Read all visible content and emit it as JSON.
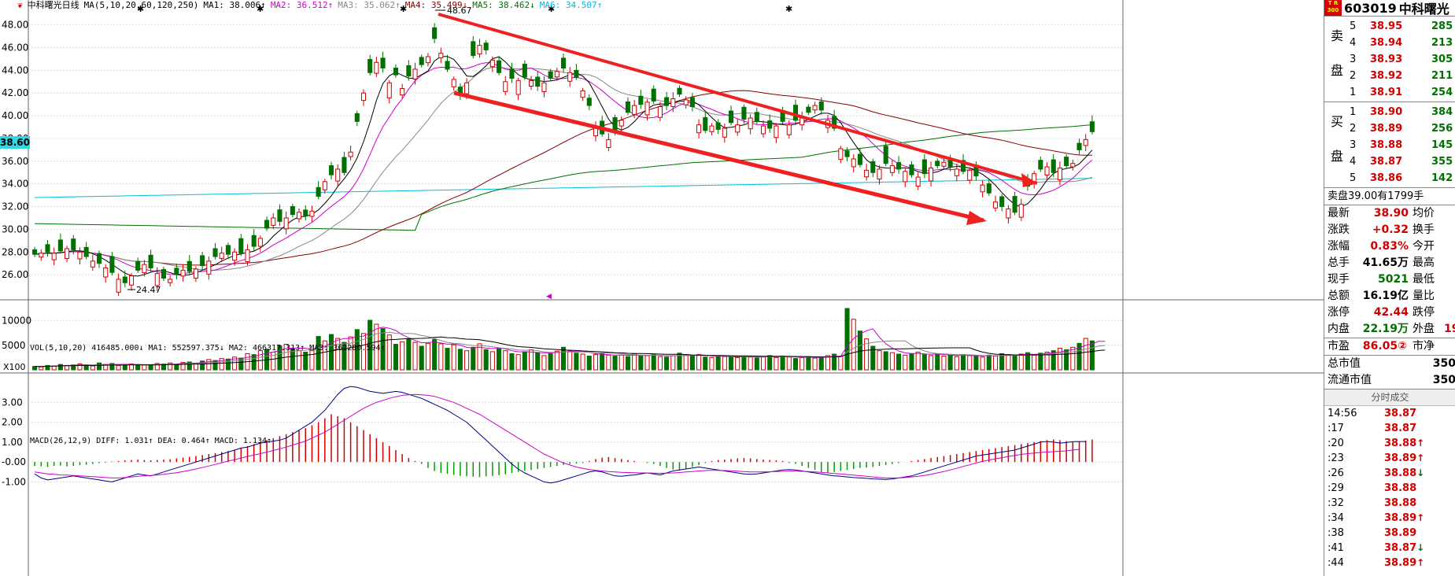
{
  "header": {
    "title_icon": "stock-logo-icon",
    "name": "中科曙光日线",
    "ma_params": "MA(5,10,20,60,120,250)",
    "ma": [
      {
        "label": "MA1: 38.006↑",
        "color": "#000000"
      },
      {
        "label": "MA2: 36.512↑",
        "color": "#cc00cc"
      },
      {
        "label": "MA3: 35.062↑",
        "color": "#888888"
      },
      {
        "label": "MA4: 35.499↓",
        "color": "#880000"
      },
      {
        "label": "MA5: 38.462↓",
        "color": "#007000"
      },
      {
        "label": "MA6: 34.507↑",
        "color": "#00b8d8"
      }
    ]
  },
  "price_axis": {
    "ticks": [
      "48.00",
      "46.00",
      "44.00",
      "42.00",
      "40.00",
      "38.00",
      "36.00",
      "34.00",
      "32.00",
      "30.00",
      "28.00",
      "26.00"
    ],
    "current": "38.60"
  },
  "annotations": {
    "high": "48.67",
    "low": "24.47"
  },
  "volume": {
    "header": "VOL(5,10,20) 416485.000↓ MA1: 552597.375↓ MA2: 466317.313↑ MA3: 362280.594↑",
    "ticks": [
      "10000",
      "5000"
    ],
    "unit": "X100"
  },
  "macd": {
    "header": "MACD(26,12,9) DIFF: 1.031↑ DEA: 0.464↑ MACD: 1.134↑",
    "ticks": [
      "3.00",
      "2.00",
      "1.00",
      "-0.00",
      "-1.00"
    ]
  },
  "right_panel": {
    "code": "603019",
    "name": "中科曙光",
    "logo_text": "T R 300",
    "sell_label": "卖盘",
    "buy_label": "买盘",
    "asks": [
      {
        "lv": "5",
        "price": "38.95",
        "vol": "285"
      },
      {
        "lv": "4",
        "price": "38.94",
        "vol": "213"
      },
      {
        "lv": "3",
        "price": "38.93",
        "vol": "305"
      },
      {
        "lv": "2",
        "price": "38.92",
        "vol": "211"
      },
      {
        "lv": "1",
        "price": "38.91",
        "vol": "254"
      }
    ],
    "bids": [
      {
        "lv": "1",
        "price": "38.90",
        "vol": "384"
      },
      {
        "lv": "2",
        "price": "38.89",
        "vol": "256"
      },
      {
        "lv": "3",
        "price": "38.88",
        "vol": "145"
      },
      {
        "lv": "4",
        "price": "38.87",
        "vol": "355"
      },
      {
        "lv": "5",
        "price": "38.86",
        "vol": "142"
      }
    ],
    "sell_line": "卖盘39.00有1799手",
    "info": [
      {
        "k": "最新",
        "v": "38.90",
        "k2": "均价",
        "c": "red"
      },
      {
        "k": "涨跌",
        "v": "+0.32",
        "k2": "换手",
        "c": "red"
      },
      {
        "k": "涨幅",
        "v": "0.83%",
        "k2": "今开",
        "c": "red"
      },
      {
        "k": "总手",
        "v": "41.65万",
        "k2": "最高",
        "c": ""
      },
      {
        "k": "现手",
        "v": "5021",
        "k2": "最低",
        "c": "grn"
      },
      {
        "k": "总额",
        "v": "16.19亿",
        "k2": "量比",
        "c": ""
      },
      {
        "k": "涨停",
        "v": "42.44",
        "k2": "跌停",
        "c": "red"
      },
      {
        "k": "内盘",
        "v": "22.19万",
        "k2": "外盘",
        "c": "grn"
      }
    ],
    "outer_frag": "19",
    "pe": {
      "k": "市盈",
      "v": "86.05②",
      "k2": "市净"
    },
    "cap": [
      {
        "k": "总市值",
        "v": "350"
      },
      {
        "k": "流通市值",
        "v": "350"
      }
    ],
    "ticks_header": "分时成交",
    "ticks": [
      {
        "t": "14:56",
        "p": "38.87",
        "a": ""
      },
      {
        "t": ":17",
        "p": "38.87",
        "a": ""
      },
      {
        "t": ":20",
        "p": "38.88",
        "a": "↑"
      },
      {
        "t": ":23",
        "p": "38.89",
        "a": "↑"
      },
      {
        "t": ":26",
        "p": "38.88",
        "a": "↓"
      },
      {
        "t": ":29",
        "p": "38.88",
        "a": ""
      },
      {
        "t": ":32",
        "p": "38.88",
        "a": ""
      },
      {
        "t": ":34",
        "p": "38.89",
        "a": "↑"
      },
      {
        "t": ":38",
        "p": "38.89",
        "a": ""
      },
      {
        "t": ":41",
        "p": "38.87",
        "a": "↓"
      },
      {
        "t": ":44",
        "p": "38.89",
        "a": "↑"
      }
    ]
  },
  "chart_data": {
    "type": "candlestick",
    "ylim": [
      24,
      49.5
    ],
    "close": [
      27.8,
      27.9,
      28.0,
      27.9,
      28.1,
      28.3,
      28.2,
      28.0,
      27.6,
      27.2,
      27.0,
      26.6,
      26.2,
      25.6,
      25.3,
      25.9,
      26.4,
      26.9,
      26.6,
      26.1,
      25.7,
      25.6,
      26.0,
      26.4,
      26.3,
      26.5,
      26.8,
      27.2,
      27.6,
      27.9,
      27.8,
      28.0,
      27.9,
      28.2,
      28.5,
      29.2,
      30.1,
      31.0,
      30.7,
      31.0,
      31.3,
      31.5,
      31.2,
      31.6,
      32.9,
      34.2,
      34.8,
      35.3,
      35.0,
      36.8,
      39.5,
      42.0,
      43.8,
      44.7,
      44.2,
      42.9,
      43.6,
      42.4,
      43.5,
      44.1,
      44.5,
      45.2,
      46.8,
      45.5,
      44.1,
      43.2,
      41.8,
      42.9,
      45.3,
      46.2,
      45.8,
      44.9,
      43.8,
      43.0,
      43.3,
      43.1,
      43.4,
      43.1,
      42.6,
      42.9,
      43.3,
      43.9,
      44.2,
      43.8,
      43.4,
      42.2,
      40.9,
      39.1,
      38.4,
      37.9,
      38.7,
      39.6,
      40.3,
      40.9,
      41.0,
      41.2,
      41.3,
      40.8,
      40.9,
      41.5,
      41.9,
      41.4,
      40.8,
      39.2,
      38.7,
      39.1,
      38.8,
      38.9,
      39.4,
      39.2,
      39.7,
      39.8,
      39.5,
      39.1,
      38.9,
      39.1,
      39.5,
      39.2,
      39.6,
      39.8,
      40.3,
      40.9,
      40.5,
      39.6,
      38.9,
      37.1,
      36.4,
      36.2,
      35.7,
      35.2,
      35.0,
      35.3,
      35.8,
      35.6,
      35.3,
      35.1,
      34.8,
      34.6,
      34.9,
      35.4,
      35.6,
      35.9,
      35.5,
      35.3,
      35.1,
      35.2,
      34.7,
      33.9,
      33.2,
      32.4,
      32.0,
      31.8,
      31.5,
      32.2,
      33.8,
      34.9,
      35.3,
      35.5,
      35.0,
      35.4,
      35.6,
      35.8,
      37.0,
      37.9,
      38.6
    ],
    "open_offsets": [
      0.4,
      -0.3,
      0.5,
      -0.4,
      0.6,
      -0.5,
      0.5,
      -0.6,
      0.7,
      -0.4,
      0.6,
      -0.5,
      0.8,
      -0.6,
      0.5,
      -0.7,
      0.6,
      -0.5,
      0.7,
      -0.6
    ],
    "volume": [
      700,
      600,
      900,
      800,
      1100,
      900,
      1000,
      1200,
      900,
      800,
      1400,
      1100,
      1300,
      900,
      1000,
      1200,
      1100,
      1000,
      900,
      1300,
      1200,
      1400,
      1100,
      1500,
      1600,
      1300,
      1800,
      2100,
      1900,
      2300,
      2200,
      2600,
      2400,
      3300,
      3100,
      3900,
      4200,
      3600,
      4900,
      5200,
      4400,
      3900,
      3600,
      3900,
      6800,
      5900,
      7200,
      6400,
      5600,
      6700,
      8200,
      7400,
      10100,
      9300,
      8400,
      7100,
      5200,
      5700,
      6300,
      5600,
      4800,
      5400,
      6200,
      5300,
      4400,
      5100,
      4200,
      3900,
      4600,
      5300,
      4100,
      3700,
      4400,
      3900,
      3300,
      3100,
      3700,
      4100,
      3500,
      2900,
      3300,
      3800,
      4600,
      3900,
      3400,
      3200,
      2800,
      3100,
      3300,
      3000,
      2800,
      3000,
      2700,
      3300,
      2800,
      2900,
      3100,
      2700,
      2600,
      2900,
      3400,
      3000,
      2800,
      3100,
      2600,
      2500,
      2900,
      2700,
      2600,
      2500,
      2800,
      2600,
      2400,
      2700,
      2900,
      2500,
      2800,
      2600,
      2300,
      2500,
      2700,
      2400,
      2600,
      2900,
      3200,
      2800,
      12500,
      10300,
      7900,
      6300,
      4800,
      3900,
      3700,
      3500,
      3200,
      3000,
      3300,
      3600,
      3100,
      2900,
      3200,
      2800,
      3000,
      2700,
      3100,
      2900,
      2800,
      2600,
      3000,
      2800,
      3300,
      3100,
      2900,
      3200,
      3500,
      3000,
      3400,
      3600,
      3900,
      4400,
      4100,
      4600,
      5400,
      6400,
      5900,
      6700,
      4600
    ],
    "macd": [
      -0.2,
      -0.22,
      -0.25,
      -0.2,
      -0.18,
      -0.22,
      -0.2,
      -0.16,
      -0.14,
      -0.1,
      -0.06,
      -0.04,
      0.02,
      0.05,
      0.08,
      0.1,
      0.12,
      0.1,
      0.08,
      0.1,
      0.12,
      0.14,
      0.18,
      0.22,
      0.26,
      0.3,
      0.35,
      0.4,
      0.45,
      0.5,
      0.55,
      0.62,
      0.7,
      0.8,
      0.9,
      1.0,
      1.1,
      1.2,
      1.3,
      1.4,
      1.5,
      1.6,
      1.7,
      1.85,
      2.0,
      2.2,
      2.4,
      2.3,
      2.2,
      2.0,
      1.8,
      1.6,
      1.4,
      1.2,
      1.0,
      0.8,
      0.6,
      0.4,
      0.2,
      0.05,
      -0.1,
      -0.3,
      -0.45,
      -0.55,
      -0.6,
      -0.65,
      -0.7,
      -0.72,
      -0.74,
      -0.76,
      -0.72,
      -0.7,
      -0.66,
      -0.62,
      -0.55,
      -0.5,
      -0.45,
      -0.4,
      -0.35,
      -0.3,
      -0.25,
      -0.2,
      -0.15,
      -0.1,
      -0.08,
      -0.05,
      0.05,
      0.15,
      0.22,
      0.25,
      0.2,
      0.15,
      0.1,
      0.05,
      0.0,
      -0.05,
      -0.1,
      -0.2,
      -0.3,
      -0.38,
      -0.42,
      -0.35,
      -0.25,
      -0.15,
      -0.05,
      0.05,
      0.1,
      0.12,
      0.15,
      0.18,
      0.2,
      0.18,
      0.15,
      0.12,
      0.1,
      0.08,
      0.05,
      -0.05,
      -0.1,
      -0.2,
      -0.3,
      -0.4,
      -0.5,
      -0.55,
      -0.5,
      -0.45,
      -0.4,
      -0.35,
      -0.3,
      -0.28,
      -0.25,
      -0.2,
      -0.15,
      -0.1,
      -0.05,
      0.0,
      0.05,
      0.1,
      0.15,
      0.2,
      0.25,
      0.3,
      0.35,
      0.4,
      0.45,
      0.5,
      0.55,
      0.6,
      0.65,
      0.7,
      0.75,
      0.8,
      0.85,
      0.9,
      0.95,
      1.0,
      1.05,
      1.1,
      1.13,
      1.1,
      1.05,
      1.0,
      1.03,
      1.08,
      1.13
    ],
    "diff": [
      -0.6,
      -0.8,
      -0.9,
      -0.85,
      -0.8,
      -0.75,
      -0.7,
      -0.75,
      -0.8,
      -0.85,
      -0.9,
      -0.95,
      -1.0,
      -0.9,
      -0.8,
      -0.7,
      -0.6,
      -0.65,
      -0.7,
      -0.6,
      -0.5,
      -0.4,
      -0.3,
      -0.2,
      -0.1,
      0.0,
      0.1,
      0.2,
      0.3,
      0.4,
      0.5,
      0.6,
      0.7,
      0.75,
      0.85,
      0.95,
      1.0,
      1.05,
      1.1,
      1.2,
      1.4,
      1.6,
      1.8,
      2.0,
      2.3,
      2.6,
      3.0,
      3.4,
      3.7,
      3.8,
      3.75,
      3.65,
      3.55,
      3.5,
      3.45,
      3.5,
      3.55,
      3.5,
      3.4,
      3.3,
      3.2,
      3.05,
      2.9,
      2.75,
      2.6,
      2.4,
      2.2,
      2.0,
      1.7,
      1.4,
      1.1,
      0.8,
      0.5,
      0.2,
      -0.1,
      -0.35,
      -0.55,
      -0.7,
      -0.85,
      -1.0,
      -1.05,
      -1.0,
      -0.9,
      -0.8,
      -0.7,
      -0.6,
      -0.5,
      -0.45,
      -0.5,
      -0.6,
      -0.7,
      -0.72,
      -0.68,
      -0.65,
      -0.6,
      -0.55,
      -0.6,
      -0.65,
      -0.55,
      -0.45,
      -0.4,
      -0.35,
      -0.3,
      -0.25,
      -0.3,
      -0.35,
      -0.4,
      -0.45,
      -0.5,
      -0.55,
      -0.6,
      -0.62,
      -0.6,
      -0.55,
      -0.5,
      -0.45,
      -0.4,
      -0.38,
      -0.4,
      -0.45,
      -0.5,
      -0.55,
      -0.6,
      -0.65,
      -0.7,
      -0.72,
      -0.75,
      -0.78,
      -0.8,
      -0.82,
      -0.85,
      -0.86,
      -0.88,
      -0.85,
      -0.8,
      -0.75,
      -0.7,
      -0.6,
      -0.5,
      -0.4,
      -0.3,
      -0.2,
      -0.1,
      0.0,
      0.1,
      0.2,
      0.3,
      0.35,
      0.4,
      0.45,
      0.5,
      0.55,
      0.6,
      0.7,
      0.8,
      0.9,
      1.0,
      1.03,
      1.0,
      0.95,
      0.98,
      1.02,
      1.03,
      1.03
    ],
    "dea": [
      -0.5,
      -0.55,
      -0.6,
      -0.62,
      -0.65,
      -0.66,
      -0.68,
      -0.7,
      -0.72,
      -0.74,
      -0.76,
      -0.78,
      -0.8,
      -0.8,
      -0.78,
      -0.75,
      -0.72,
      -0.7,
      -0.68,
      -0.65,
      -0.62,
      -0.58,
      -0.54,
      -0.48,
      -0.42,
      -0.35,
      -0.28,
      -0.2,
      -0.12,
      -0.04,
      0.05,
      0.12,
      0.2,
      0.28,
      0.35,
      0.42,
      0.5,
      0.58,
      0.66,
      0.75,
      0.85,
      0.95,
      1.05,
      1.2,
      1.35,
      1.5,
      1.7,
      1.9,
      2.1,
      2.3,
      2.5,
      2.7,
      2.85,
      3.0,
      3.1,
      3.2,
      3.28,
      3.35,
      3.38,
      3.4,
      3.38,
      3.35,
      3.3,
      3.2,
      3.1,
      3.0,
      2.85,
      2.7,
      2.55,
      2.4,
      2.2,
      2.0,
      1.8,
      1.6,
      1.4,
      1.2,
      1.0,
      0.8,
      0.6,
      0.4,
      0.25,
      0.1,
      -0.05,
      -0.15,
      -0.25,
      -0.32,
      -0.38,
      -0.42,
      -0.45,
      -0.48,
      -0.5,
      -0.52,
      -0.53,
      -0.54,
      -0.55,
      -0.55,
      -0.56,
      -0.57,
      -0.56,
      -0.55,
      -0.53,
      -0.5,
      -0.48,
      -0.45,
      -0.43,
      -0.42,
      -0.42,
      -0.43,
      -0.44,
      -0.46,
      -0.48,
      -0.5,
      -0.5,
      -0.5,
      -0.49,
      -0.48,
      -0.47,
      -0.46,
      -0.46,
      -0.47,
      -0.48,
      -0.5,
      -0.52,
      -0.55,
      -0.58,
      -0.6,
      -0.63,
      -0.66,
      -0.69,
      -0.72,
      -0.75,
      -0.78,
      -0.8,
      -0.8,
      -0.8,
      -0.78,
      -0.75,
      -0.72,
      -0.68,
      -0.62,
      -0.55,
      -0.48,
      -0.4,
      -0.32,
      -0.22,
      -0.14,
      -0.05,
      0.03,
      0.1,
      0.16,
      0.22,
      0.28,
      0.33,
      0.38,
      0.42,
      0.45,
      0.48,
      0.5,
      0.52,
      0.54,
      0.56,
      0.6,
      0.64
    ]
  }
}
